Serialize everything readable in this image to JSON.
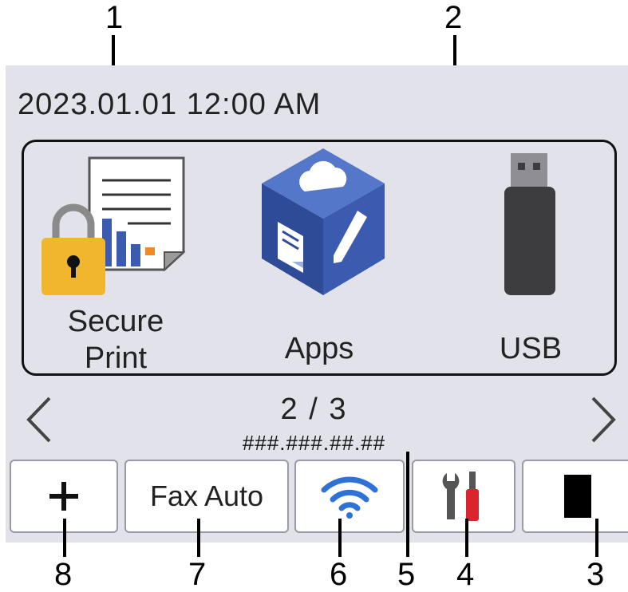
{
  "callouts": {
    "c1": "1",
    "c2": "2",
    "c3": "3",
    "c4": "4",
    "c5": "5",
    "c6": "6",
    "c7": "7",
    "c8": "8"
  },
  "status_bar": {
    "date_time": "2023.01.01  12:00  AM"
  },
  "apps": [
    {
      "label": "Secure\nPrint",
      "icon": "secure-print-icon"
    },
    {
      "label": "Apps",
      "icon": "apps-cube-icon"
    },
    {
      "label": "USB",
      "icon": "usb-drive-icon"
    }
  ],
  "pagination": {
    "text": "2 / 3"
  },
  "network": {
    "ip_address": "###.###.##.##"
  },
  "bottom_bar": {
    "shortcut_add": {
      "icon": "plus-icon"
    },
    "fax_mode": {
      "label": "Fax Auto"
    },
    "wifi": {
      "icon": "wifi-icon"
    },
    "settings": {
      "icon": "settings-tools-icon"
    },
    "toner": {
      "icon": "toner-icon"
    }
  },
  "colors": {
    "screen_bg": "#e2e2ea",
    "apps_blue": "#3a5bb0",
    "lock_yellow": "#f2b62e",
    "usb_dark": "#3d3d40",
    "wifi_blue": "#2f72d6",
    "screwdriver_red": "#d9252b"
  }
}
